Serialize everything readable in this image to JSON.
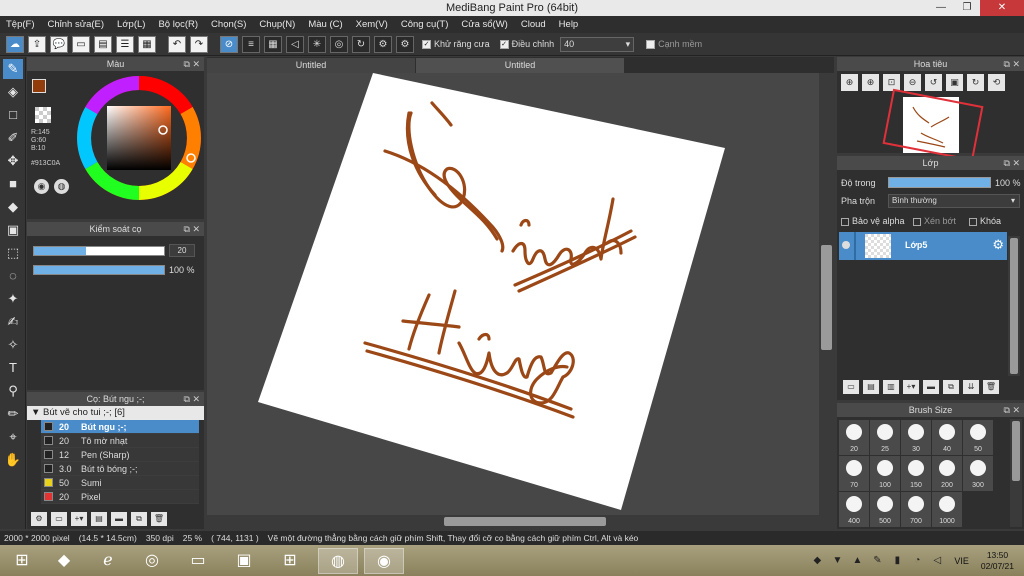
{
  "window": {
    "title": "MediBang Paint Pro (64bit)"
  },
  "menu": [
    "Tệp(F)",
    "Chỉnh sửa(E)",
    "Lớp(L)",
    "Bộ lọc(R)",
    "Chọn(S)",
    "Chụp(N)",
    "Màu (C)",
    "Xem(V)",
    "Công cụ(T)",
    "Cửa sổ(W)",
    "Cloud",
    "Help"
  ],
  "toolbar": {
    "antialias_label": "Khử răng cưa",
    "correction_label": "Điều chỉnh",
    "correction_value": "40",
    "soft_edge_label": "Cạnh mềm"
  },
  "color_panel": {
    "title": "Màu",
    "r": "R:145",
    "g": "G:60",
    "b": "B:10",
    "hex": "#913C0A",
    "main_color": "#913c0a"
  },
  "brush_control": {
    "title": "Kiểm soát cọ",
    "size_value": "20",
    "size_fill": 0.4,
    "opacity_value": "100 %",
    "opacity_fill": 1.0
  },
  "brush_list": {
    "title": "Cọ: Bút ngu ;-;",
    "group": "Bút vẽ cho tui ;-; [6]",
    "items": [
      {
        "num": "20",
        "name": "Bút ngu ;-;",
        "color": "#222222",
        "selected": true
      },
      {
        "num": "20",
        "name": "Tô mờ nhạt",
        "color": "#222222",
        "selected": false
      },
      {
        "num": "12",
        "name": "Pen (Sharp)",
        "color": "#222222",
        "selected": false
      },
      {
        "num": "3.0",
        "name": "Bút tô bóng ;-;",
        "color": "#222222",
        "selected": false
      },
      {
        "num": "50",
        "name": "Sumi",
        "color": "#e8d21a",
        "selected": false
      },
      {
        "num": "20",
        "name": "Pixel",
        "color": "#e23232",
        "selected": false
      }
    ]
  },
  "tabs": [
    "Untitled",
    "Untitled"
  ],
  "navigator": {
    "title": "Hoa tiêu"
  },
  "layers": {
    "title": "Lớp",
    "opacity_label": "Độ trong",
    "opacity_value": "100 %",
    "blend_label": "Pha trộn",
    "blend_value": "Bình thường",
    "protect_alpha": "Bảo vệ alpha",
    "clipping": "Xén bớt",
    "lock": "Khóa",
    "layer_name": "Lớp5"
  },
  "brush_size": {
    "title": "Brush Size",
    "sizes": [
      "20",
      "25",
      "30",
      "40",
      "50",
      "70",
      "100",
      "150",
      "200",
      "300",
      "400",
      "500",
      "700",
      "1000"
    ]
  },
  "status": {
    "size": "2000 * 2000 pixel",
    "physical": "(14.5 * 14.5cm)",
    "dpi": "350 dpi",
    "zoom": "25 %",
    "coords": "( 744, 1131 )",
    "hint": "Vẽ một đường thẳng bằng cách giữ phím Shift, Thay đổi cỡ cọ bằng cách giữ phím Ctrl, Alt và kéo"
  },
  "taskbar": {
    "lang": "VIE",
    "time": "13:50",
    "date": "02/07/21"
  },
  "canvas_text": [
    "Nguyễn",
    "Mạnh",
    "Hùng"
  ],
  "colors": {
    "accent": "#4a8cca",
    "ink": "#9b4716"
  }
}
